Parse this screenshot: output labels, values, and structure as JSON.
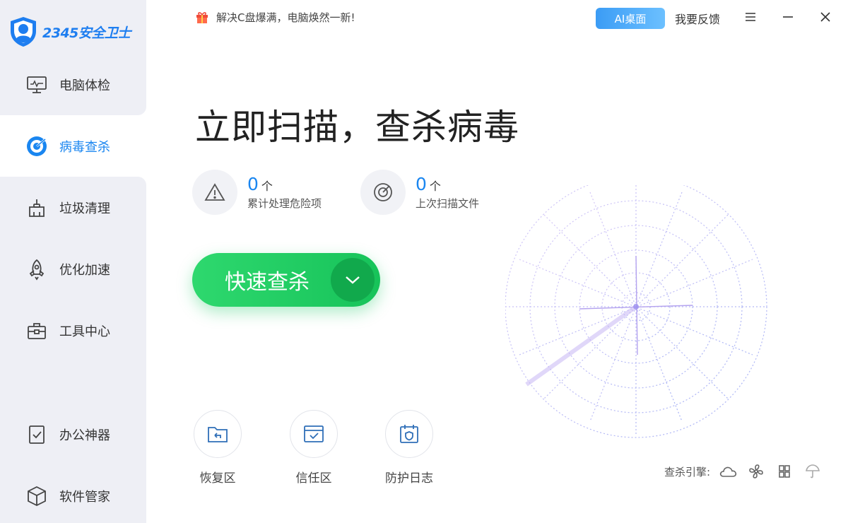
{
  "app": {
    "logo_text": "2345安全卫士"
  },
  "sidebar": {
    "items": [
      {
        "label": "电脑体检",
        "icon": "monitor-icon",
        "active": false
      },
      {
        "label": "病毒查杀",
        "icon": "target-icon",
        "active": true
      },
      {
        "label": "垃圾清理",
        "icon": "broom-icon",
        "active": false
      },
      {
        "label": "优化加速",
        "icon": "rocket-icon",
        "active": false
      },
      {
        "label": "工具中心",
        "icon": "toolbox-icon",
        "active": false
      },
      {
        "label": "办公神器",
        "icon": "document-check-icon",
        "active": false
      },
      {
        "label": "软件管家",
        "icon": "package-icon",
        "active": false
      }
    ]
  },
  "topbar": {
    "promo_text": "解决C盘爆满，电脑焕然一新!",
    "ai_button": "AI桌面",
    "feedback": "我要反馈"
  },
  "main": {
    "headline": "立即扫描，查杀病毒",
    "stats": [
      {
        "value": "0",
        "unit": "个",
        "label": "累计处理危险项"
      },
      {
        "value": "0",
        "unit": "个",
        "label": "上次扫描文件"
      }
    ],
    "scan_button": "快速查杀",
    "tools": [
      {
        "label": "恢复区"
      },
      {
        "label": "信任区"
      },
      {
        "label": "防护日志"
      }
    ],
    "engine_label": "查杀引擎:"
  },
  "colors": {
    "accent": "#1a86f0",
    "scan_green": "#1fcf63",
    "sidebar_bg": "#eeeff5",
    "radar": "#8b7ee8"
  }
}
